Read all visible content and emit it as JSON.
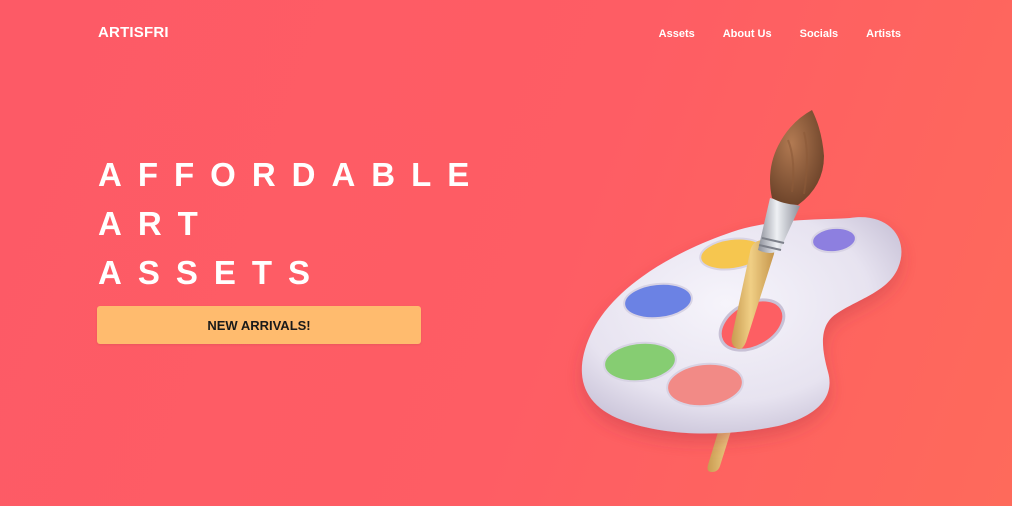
{
  "brand": {
    "logo": "ARTISFRI"
  },
  "nav": {
    "items": [
      {
        "label": "Assets"
      },
      {
        "label": "About Us"
      },
      {
        "label": "Socials"
      },
      {
        "label": "Artists"
      }
    ]
  },
  "hero": {
    "title_lines": [
      "AFFORDABLE",
      "ART",
      "ASSETS"
    ],
    "cta_label": "NEW ARRIVALS!"
  },
  "illustration": {
    "icon": "paint-palette-with-brush-icon",
    "paint_colors": {
      "yellow": "#f6c64f",
      "purple": "#8d7fe0",
      "blue": "#6b82e4",
      "green": "#86cd72",
      "pink": "#f28a86"
    }
  },
  "colors": {
    "background": "#fd5c65",
    "cta_background": "#ffbb6e",
    "text": "#ffffff"
  }
}
